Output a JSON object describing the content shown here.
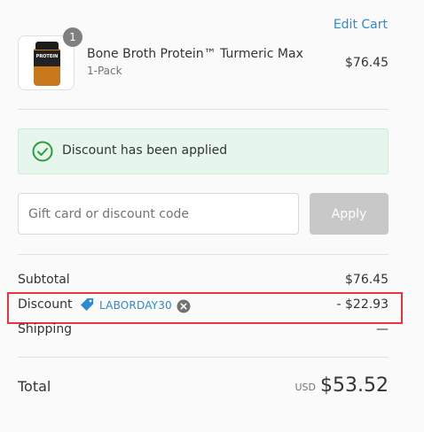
{
  "header": {
    "edit_cart_label": "Edit Cart"
  },
  "product": {
    "name": "Bone Broth Protein™ Turmeric Max",
    "variant": "1-Pack",
    "price": "$76.45",
    "quantity": "1",
    "image_label": "PROTEIN"
  },
  "notice": {
    "text": "Discount has been applied"
  },
  "discount_form": {
    "placeholder": "Gift card or discount code",
    "apply_label": "Apply"
  },
  "summary": {
    "subtotal_label": "Subtotal",
    "subtotal_value": "$76.45",
    "discount_label": "Discount",
    "discount_code": "LABORDAY30",
    "discount_value": "- $22.93",
    "shipping_label": "Shipping",
    "shipping_value": "—"
  },
  "total": {
    "label": "Total",
    "currency": "USD",
    "value": "$53.52"
  },
  "colors": {
    "accent": "#2a8ad4",
    "success": "#2a9d3c",
    "notice_bg": "#e6f6ec",
    "highlight": "#e8343c",
    "apply_disabled": "#c8c8c8"
  }
}
